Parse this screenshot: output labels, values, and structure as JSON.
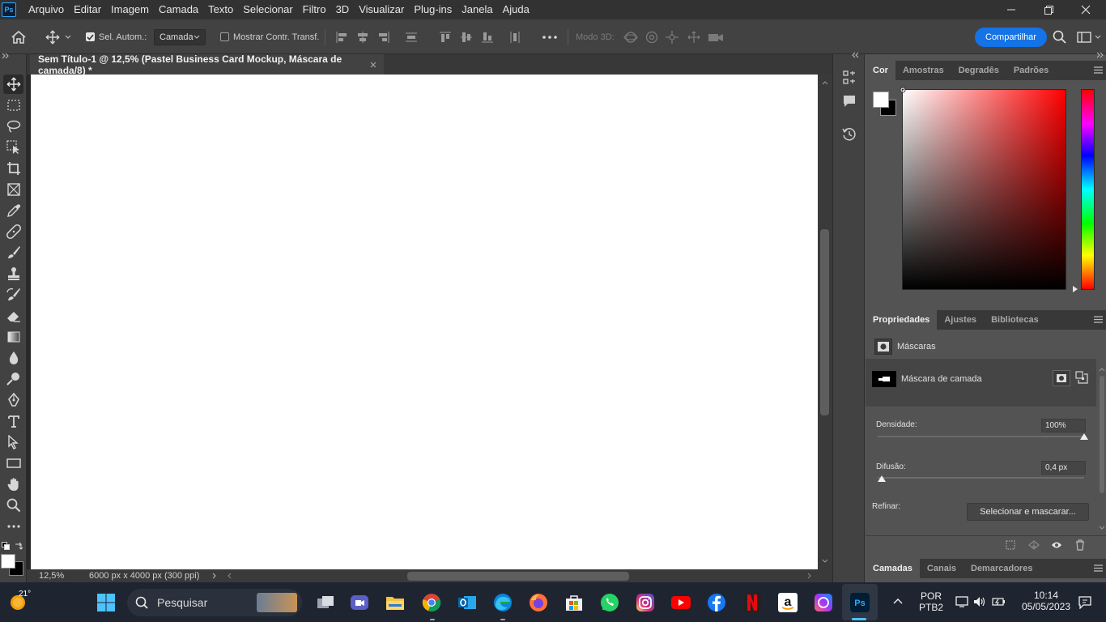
{
  "app": {
    "logo": "Ps"
  },
  "menu": [
    "Arquivo",
    "Editar",
    "Imagem",
    "Camada",
    "Texto",
    "Selecionar",
    "Filtro",
    "3D",
    "Visualizar",
    "Plug-ins",
    "Janela",
    "Ajuda"
  ],
  "options": {
    "auto_select_label": "Sel. Autom.:",
    "auto_select_checked": true,
    "auto_select_target": "Camada",
    "show_transform_label": "Mostrar Contr. Transf.",
    "show_transform_checked": false,
    "mode3d_label": "Modo 3D:",
    "share_label": "Compartilhar"
  },
  "document": {
    "tab_title": "Sem Título-1 @ 12,5% (Pastel Business Card Mockup, Máscara de camada/8) *",
    "zoom": "12,5%",
    "dimensions": "6000 px x 4000 px (300 ppi)"
  },
  "color_panel": {
    "tabs": [
      "Cor",
      "Amostras",
      "Degradês",
      "Padrões"
    ],
    "active_tab": "Cor",
    "foreground": "#ffffff",
    "background": "#000000",
    "hue": "#ff0000"
  },
  "properties_panel": {
    "tabs": [
      "Propriedades",
      "Ajustes",
      "Bibliotecas"
    ],
    "active_tab": "Propriedades",
    "section_title": "Máscaras",
    "mask_label": "Máscara de camada",
    "density_label": "Densidade:",
    "density_value": "100%",
    "density_fraction": 1.0,
    "feather_label": "Difusão:",
    "feather_value": "0,4 px",
    "refine_label": "Refinar:",
    "select_mask_button": "Selecionar e mascarar..."
  },
  "layers_panel": {
    "tabs": [
      "Camadas",
      "Canais",
      "Demarcadores"
    ],
    "active_tab": "Camadas"
  },
  "taskbar": {
    "weather_temp": "21°",
    "search_placeholder": "Pesquisar",
    "language_line1": "POR",
    "language_line2": "PTB2",
    "time": "10:14",
    "date": "05/05/2023"
  }
}
